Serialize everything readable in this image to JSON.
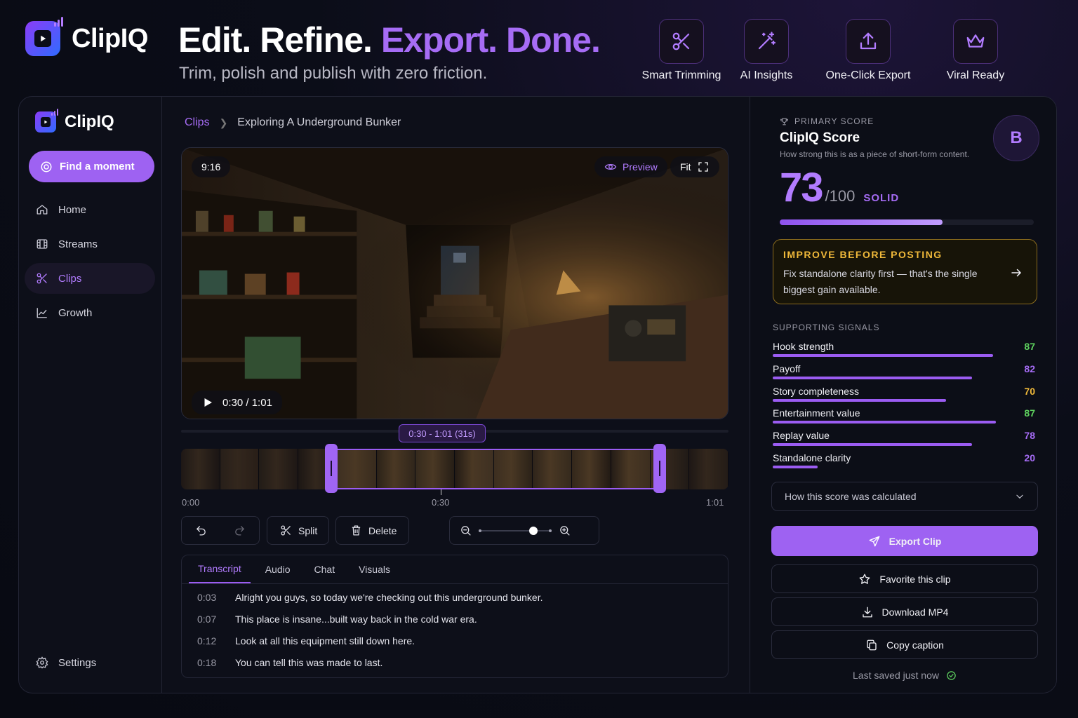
{
  "hero": {
    "brand": "ClipIQ",
    "title_white": "Edit. Refine.",
    "title_purple": "Export. Done.",
    "subtitle": "Trim, polish and publish with zero friction.",
    "features": [
      {
        "label": "Smart Trimming",
        "icon": "scissors-icon"
      },
      {
        "label": "AI Insights",
        "icon": "magic-wand-icon"
      },
      {
        "label": "One-Click Export",
        "icon": "upload-icon"
      },
      {
        "label": "Viral Ready",
        "icon": "crown-icon"
      }
    ]
  },
  "sidebar": {
    "brand": "ClipIQ",
    "find_button": "Find a moment",
    "items": [
      {
        "label": "Home",
        "icon": "home-icon",
        "active": false
      },
      {
        "label": "Streams",
        "icon": "film-icon",
        "active": false
      },
      {
        "label": "Clips",
        "icon": "scissors-icon",
        "active": true
      },
      {
        "label": "Growth",
        "icon": "chart-icon",
        "active": false
      }
    ],
    "settings": "Settings"
  },
  "breadcrumb": {
    "root": "Clips",
    "current": "Exploring A Underground Bunker"
  },
  "player": {
    "aspect": "9:16",
    "preview_label": "Preview",
    "fit_label": "Fit",
    "current_time": "0:30",
    "separator": "/",
    "duration": "1:01",
    "progress_fraction": 0.49
  },
  "timeline": {
    "range_label": "0:30 - 1:01 (31s)",
    "start_label": "0:00",
    "playhead_label": "0:30",
    "end_label": "1:01",
    "selection_start_fraction": 0.275,
    "selection_end_fraction": 0.875
  },
  "toolbar": {
    "split": "Split",
    "delete": "Delete",
    "zoom_level": 0.75
  },
  "transcript": {
    "tabs": [
      "Transcript",
      "Audio",
      "Chat",
      "Visuals"
    ],
    "active_tab": 0,
    "lines": [
      {
        "time": "0:03",
        "text": "Alright you guys, so today we're checking out this underground bunker."
      },
      {
        "time": "0:07",
        "text": "This place is insane...built way back in the cold war era."
      },
      {
        "time": "0:12",
        "text": "Look at all this equipment still down here."
      },
      {
        "time": "0:18",
        "text": "You can tell this was made to last."
      }
    ]
  },
  "score": {
    "eyebrow": "PRIMARY SCORE",
    "title": "ClipIQ Score",
    "description": "How strong this is as a piece of short-form content.",
    "grade": "B",
    "value": "73",
    "max": "/100",
    "verdict": "SOLID",
    "fraction": 0.64
  },
  "improve": {
    "heading": "IMPROVE BEFORE POSTING",
    "body": "Fix standalone clarity first — that's the single biggest gain available."
  },
  "signals": {
    "label": "SUPPORTING SIGNALS",
    "items": [
      {
        "name": "Hook strength",
        "value": "87",
        "fraction": 0.84,
        "color": "#5fd35f"
      },
      {
        "name": "Payoff",
        "value": "82",
        "fraction": 0.76,
        "color": "#a66cf5"
      },
      {
        "name": "Story completeness",
        "value": "70",
        "fraction": 0.66,
        "color": "#f0b93a"
      },
      {
        "name": "Entertainment value",
        "value": "87",
        "fraction": 0.85,
        "color": "#5fd35f"
      },
      {
        "name": "Replay value",
        "value": "78",
        "fraction": 0.76,
        "color": "#a66cf5"
      },
      {
        "name": "Standalone clarity",
        "value": "20",
        "fraction": 0.17,
        "color": "#a66cf5"
      }
    ]
  },
  "actions": {
    "calc": "How this score was calculated",
    "export": "Export Clip",
    "favorite": "Favorite this clip",
    "download": "Download MP4",
    "copy": "Copy caption",
    "saved": "Last saved just now"
  },
  "colors": {
    "accent": "#9e62f2",
    "accent_text": "#b27cff",
    "warning": "#f0b93a",
    "success": "#5fd35f",
    "background": "#0b0d18"
  }
}
